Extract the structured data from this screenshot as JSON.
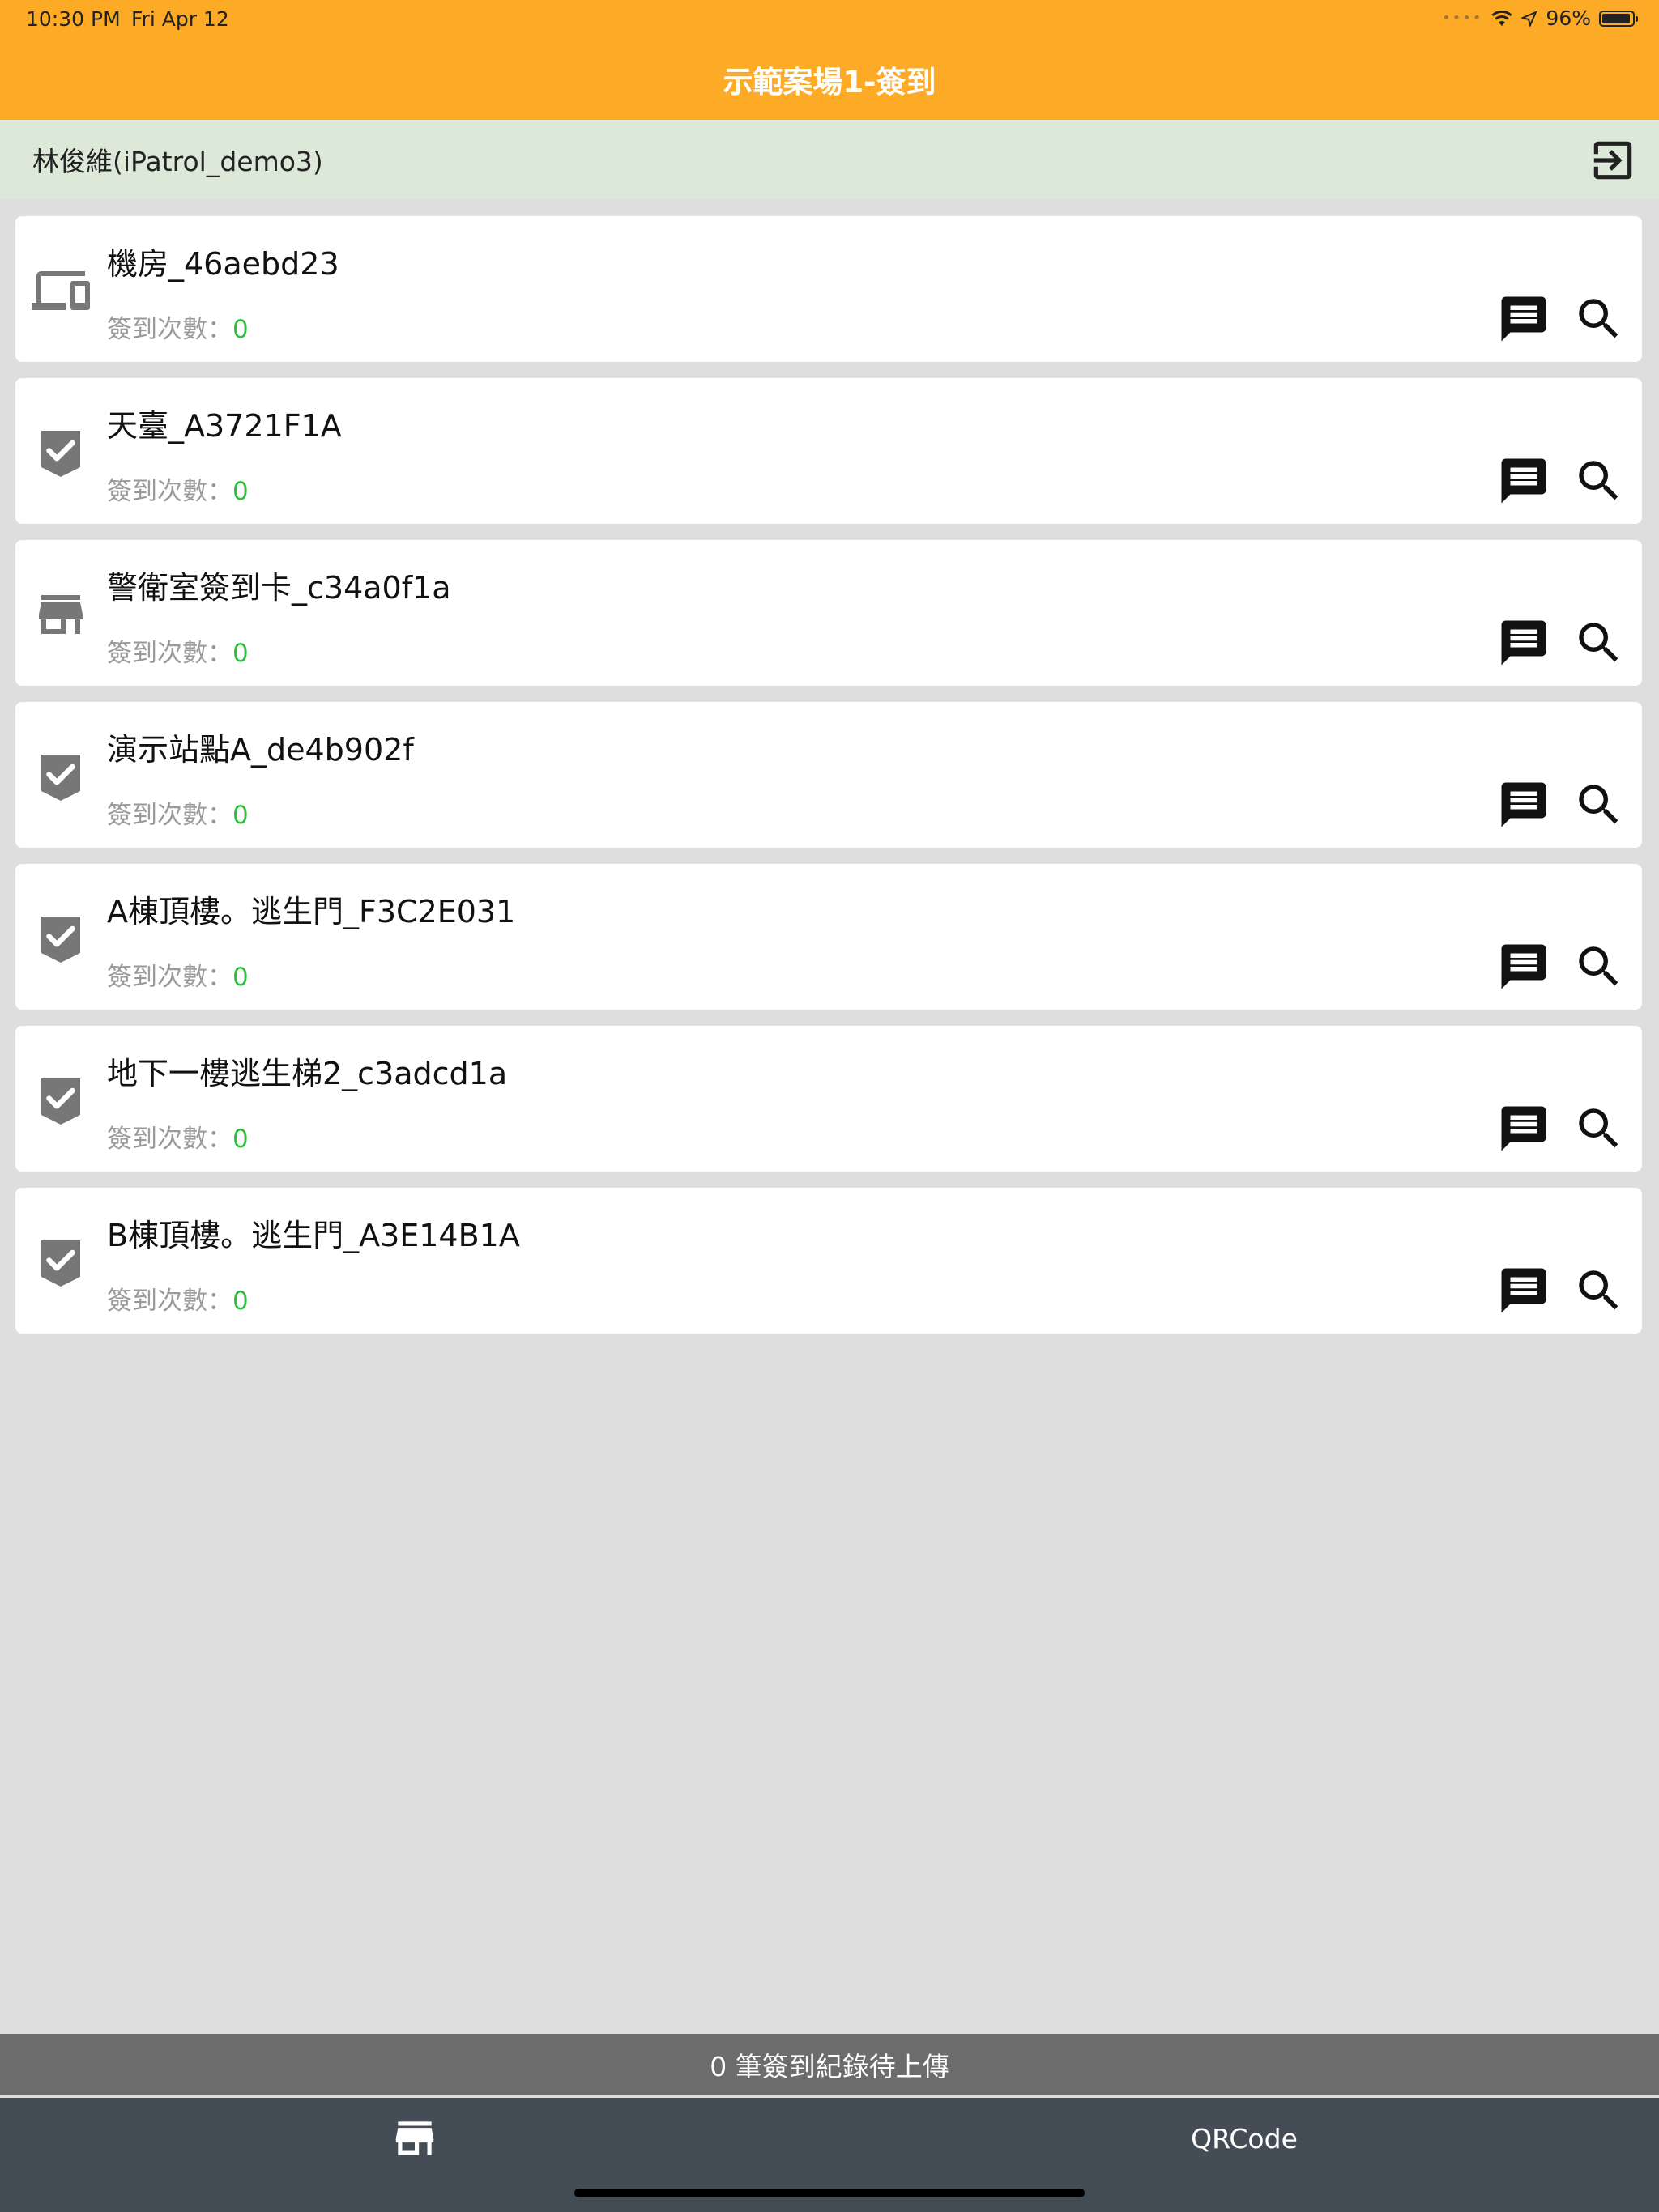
{
  "status_bar": {
    "time": "10:30 PM",
    "date": "Fri Apr 12",
    "battery": "96%"
  },
  "nav": {
    "title": "示範案場1-簽到"
  },
  "user": {
    "name": "林俊維(iPatrol_demo3)"
  },
  "checkpoints": [
    {
      "title": "機房_46aebd23",
      "count_label": "簽到次數：",
      "count": "0",
      "icon": "devices-icon"
    },
    {
      "title": "天臺_A3721F1A",
      "count_label": "簽到次數：",
      "count": "0",
      "icon": "check-badge-icon"
    },
    {
      "title": "警衛室簽到卡_c34a0f1a",
      "count_label": "簽到次數：",
      "count": "0",
      "icon": "store-icon"
    },
    {
      "title": "演示站點A_de4b902f",
      "count_label": "簽到次數：",
      "count": "0",
      "icon": "check-badge-icon"
    },
    {
      "title": "A棟頂樓。逃生門_F3C2E031",
      "count_label": "簽到次數：",
      "count": "0",
      "icon": "check-badge-icon"
    },
    {
      "title": "地下一樓逃生梯2_c3adcd1a",
      "count_label": "簽到次數：",
      "count": "0",
      "icon": "check-badge-icon"
    },
    {
      "title": "B棟頂樓。逃生門_A3E14B1A",
      "count_label": "簽到次數：",
      "count": "0",
      "icon": "check-badge-icon"
    }
  ],
  "pending": {
    "text": "0 筆簽到紀錄待上傳"
  },
  "tabs": {
    "left_icon": "store-icon",
    "right_label": "QRCode"
  },
  "colors": {
    "accent": "#fdab27",
    "user_bar": "#dce8d8",
    "count": "#2fbf3b",
    "tab_bar": "#444c55",
    "pending_bar": "#6c6c6c"
  }
}
